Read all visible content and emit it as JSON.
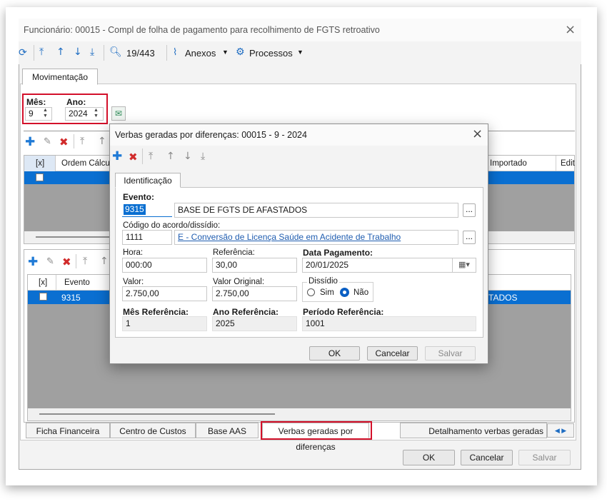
{
  "window": {
    "title": "Funcionário: 00015 - Compl de folha de pagamento para recolhimento de FGTS retroativo",
    "toolbar": {
      "record_counter": "19/443",
      "anexos": "Anexos",
      "processos": "Processos"
    },
    "tab_movimentacao": "Movimentação",
    "mes_label": "Mês:",
    "mes_value": "9",
    "ano_label": "Ano:",
    "ano_value": "2024",
    "grid1": {
      "col_x": "[x]",
      "col_ordem": "Ordem Cálculo",
      "col_importado": "Importado",
      "col_edit": "Edit"
    },
    "grid2": {
      "col_x": "[x]",
      "col_evento": "Evento",
      "row_evento": "9315",
      "row_suffix": "TADOS"
    },
    "bottom_tabs": [
      "Ficha Financeira",
      "Centro de Custos",
      "Base AAS",
      "Verbas geradas por diferenças",
      "Detalhamento verbas geradas"
    ],
    "buttons": {
      "ok": "OK",
      "cancel": "Cancelar",
      "save": "Salvar"
    }
  },
  "dialog": {
    "title": "Verbas geradas por diferenças: 00015 - 9 - 2024",
    "tab": "Identificação",
    "evento_label": "Evento:",
    "evento_code": "9315",
    "evento_desc": "BASE DE FGTS DE AFASTADOS",
    "acordo_label": "Código do acordo/dissídio:",
    "acordo_code": "1111",
    "acordo_desc": "E - Conversão de Licença Saúde em Acidente de Trabalho",
    "hora_label": "Hora:",
    "hora_value": "000:00",
    "ref_label": "Referência:",
    "ref_value": "30,00",
    "datapag_label": "Data Pagamento:",
    "datapag_value": "20/01/2025",
    "valor_label": "Valor:",
    "valor_value": "2.750,00",
    "valororig_label": "Valor Original:",
    "valororig_value": "2.750,00",
    "dissidio_label": "Dissídio",
    "sim": "Sim",
    "nao": "Não",
    "mesref_label": "Mês Referência:",
    "mesref_value": "1",
    "anoref_label": "Ano Referência:",
    "anoref_value": "2025",
    "periodo_label": "Período Referência:",
    "periodo_value": "1001",
    "ellipsis": "...",
    "buttons": {
      "ok": "OK",
      "cancel": "Cancelar",
      "save": "Salvar"
    }
  }
}
